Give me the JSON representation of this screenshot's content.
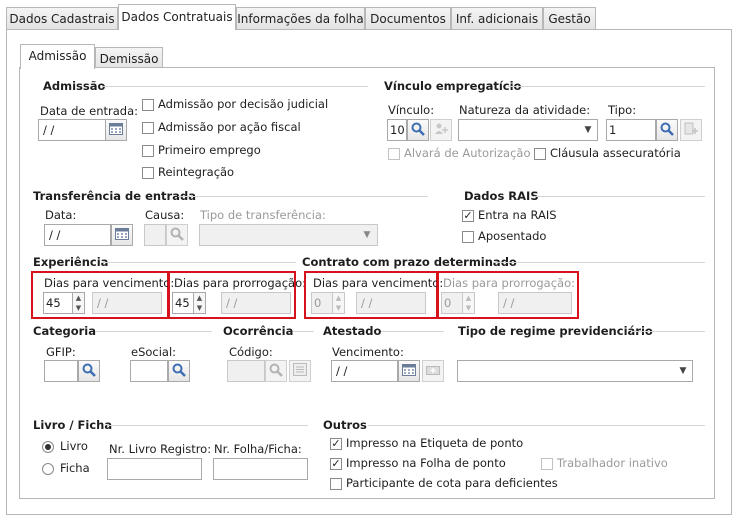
{
  "tabs": [
    "Dados Cadastrais",
    "Dados Contratuais",
    "Informações da folha",
    "Documentos",
    "Inf. adicionais",
    "Gestão"
  ],
  "subtabs": [
    "Admissão",
    "Demissão"
  ],
  "admissao": {
    "title": "Admissão",
    "data_entrada_label": "Data de entrada:",
    "data_entrada_value": "/ /",
    "checks": [
      "Admissão por decisão judicial",
      "Admissão por ação fiscal",
      "Primeiro emprego",
      "Reintegração"
    ]
  },
  "vinculo": {
    "title": "Vínculo empregatício",
    "vinculo_label": "Vínculo:",
    "vinculo_value": "10",
    "natureza_label": "Natureza da atividade:",
    "tipo_label": "Tipo:",
    "tipo_value": "1",
    "alvara_label": "Alvará de Autorização",
    "clausula_label": "Cláusula assecuratória"
  },
  "transferencia": {
    "title": "Transferência de entrada",
    "data_label": "Data:",
    "data_value": "/ /",
    "causa_label": "Causa:",
    "tipo_label": "Tipo de transferência:"
  },
  "rais": {
    "title": "Dados RAIS",
    "entra_label": "Entra na RAIS",
    "aposentado_label": "Aposentado"
  },
  "experiencia": {
    "title": "Experiência",
    "venc_label": "Dias para vencimento:",
    "venc_value": "45",
    "venc_date": "/ /",
    "prorrog_label": "Dias para prorrogação:",
    "prorrog_value": "45",
    "prorrog_date": "/ /"
  },
  "contrato": {
    "title": "Contrato com prazo determinado",
    "venc_label": "Dias para vencimento:",
    "venc_value": "0",
    "venc_date": "/ /",
    "prorrog_label": "Dias para prorrogação:",
    "prorrog_value": "0",
    "prorrog_date": "/ /"
  },
  "categoria": {
    "title": "Categoria",
    "gfip_label": "GFIP:",
    "esocial_label": "eSocial:"
  },
  "ocorrencia": {
    "title": "Ocorrência",
    "codigo_label": "Código:"
  },
  "atestado": {
    "title": "Atestado",
    "vencimento_label": "Vencimento:",
    "vencimento_value": "/ /"
  },
  "regime": {
    "title": "Tipo de regime previdenciário"
  },
  "livro": {
    "title": "Livro / Ficha",
    "opt_livro": "Livro",
    "opt_ficha": "Ficha",
    "nr_livro_label": "Nr. Livro Registro:",
    "nr_folha_label": "Nr. Folha/Ficha:"
  },
  "outros": {
    "title": "Outros",
    "etiqueta_label": "Impresso na Etiqueta de ponto",
    "folha_label": "Impresso na Folha de ponto",
    "inativo_label": "Trabalhador inativo",
    "cota_label": "Participante de cota para deficientes"
  },
  "colors": {
    "red_highlight": "#d6121a",
    "border": "#b7b7b7",
    "disabled_text": "#9a9a9a"
  }
}
